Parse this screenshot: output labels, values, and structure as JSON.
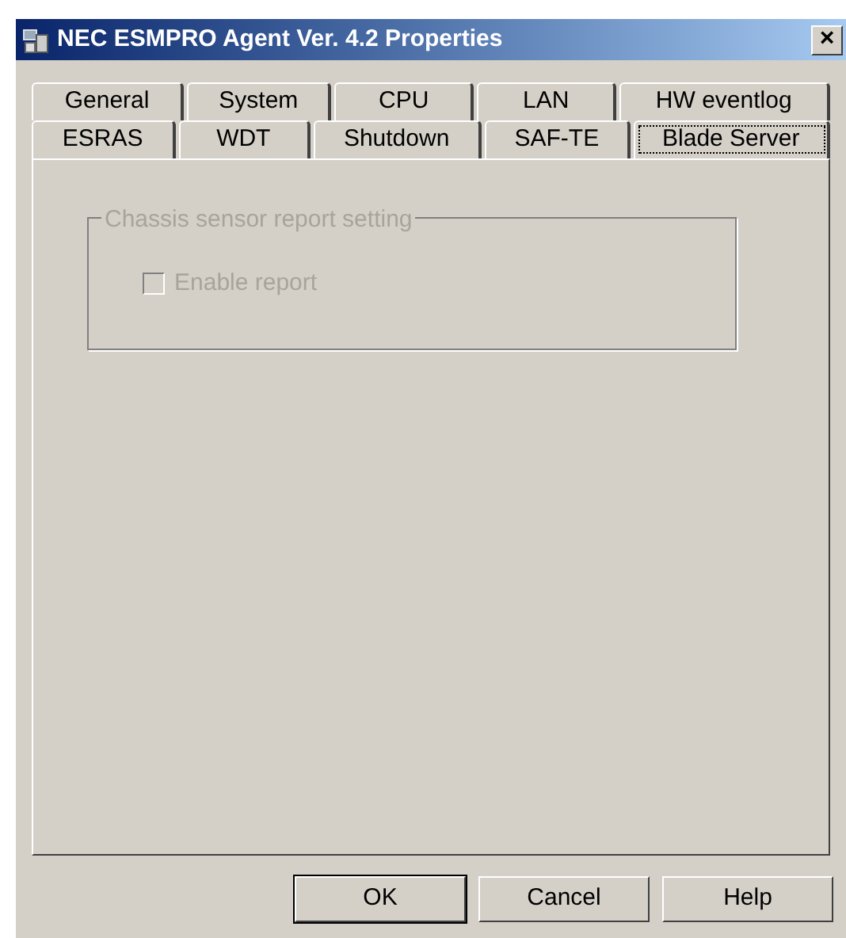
{
  "window": {
    "title": "NEC ESMPRO Agent Ver. 4.2 Properties",
    "close": "×"
  },
  "tab_rows": [
    [
      {
        "label": "General",
        "selected": false
      },
      {
        "label": "System",
        "selected": false
      },
      {
        "label": "CPU",
        "selected": false
      },
      {
        "label": "LAN",
        "selected": false
      },
      {
        "label": "HW eventlog",
        "selected": false
      }
    ],
    [
      {
        "label": "ESRAS",
        "selected": false
      },
      {
        "label": "WDT",
        "selected": false
      },
      {
        "label": "Shutdown",
        "selected": false
      },
      {
        "label": "SAF-TE",
        "selected": false
      },
      {
        "label": "Blade Server",
        "selected": true
      }
    ]
  ],
  "group": {
    "title": "Chassis sensor report setting",
    "disabled": true,
    "checkbox": {
      "label": "Enable report",
      "checked": false,
      "disabled": true
    }
  },
  "buttons": [
    {
      "label": "OK",
      "default": true
    },
    {
      "label": "Cancel",
      "default": false
    },
    {
      "label": "Help",
      "default": false
    }
  ]
}
